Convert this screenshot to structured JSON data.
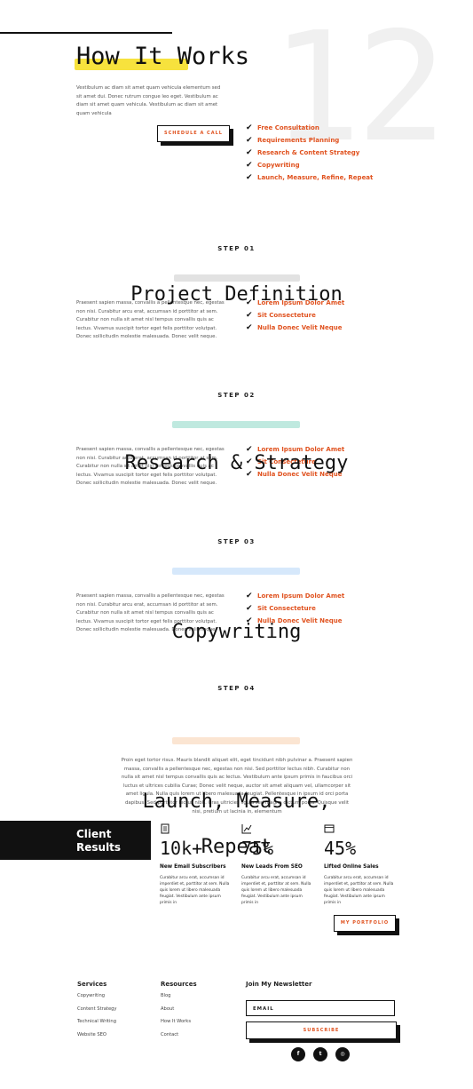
{
  "hero": {
    "big_number": "12",
    "title": "How It Works",
    "description": "Vestibulum ac diam sit amet quam vehicula elementum sed sit amet dui. Donec rutrum congue leo eget. Vestibulum ac diam sit amet quam vehicula. Vestibulum ac diam sit amet quam vehicula",
    "button_label": "SCHEDULE A CALL",
    "checklist": [
      "Free Consultation",
      "Requirements Planning",
      "Research & Content Strategy",
      "Copywriting",
      "Launch, Measure, Refine, Repeat"
    ]
  },
  "steps": [
    {
      "label": "STEP 01",
      "title": "Project Definition",
      "body": "Praesent sapien massa, convallis a pellentesque nec, egestas non nisi. Curabitur arcu erat, accumsan id porttitor at sem. Curabitur non nulla sit amet nisl tempus convallis quis ac lectus. Vivamus suscipit tortor eget felis porttitor volutpat. Donec sollicitudin molestie malesuada. Donec velit neque.",
      "checklist": [
        "Lorem Ipsum Dolor Amet",
        "Sit Consecteture",
        "Nulla Donec Velit Neque"
      ]
    },
    {
      "label": "STEP 02",
      "title": "Research & Strategy",
      "body": "Praesent sapien massa, convallis a pellentesque nec, egestas non nisi. Curabitur arcu erat, accumsan id porttitor at sem. Curabitur non nulla sit amet nisl tempus convallis quis ac lectus. Vivamus suscipit tortor eget felis porttitor volutpat. Donec sollicitudin molestie malesuada. Donec velit neque.",
      "checklist": [
        "Lorem Ipsum Dolor Amet",
        "Sit Consecteture",
        "Nulla Donec Velit Neque"
      ]
    },
    {
      "label": "STEP 03",
      "title": "Copywriting",
      "body": "Praesent sapien massa, convallis a pellentesque nec, egestas non nisi. Curabitur arcu erat, accumsan id porttitor at sem. Curabitur non nulla sit amet nisl tempus convallis quis ac lectus. Vivamus suscipit tortor eget felis porttitor volutpat. Donec sollicitudin molestie malesuada. Donec velit neque.",
      "checklist": [
        "Lorem Ipsum Dolor Amet",
        "Sit Consecteture",
        "Nulla Donec Velit Neque"
      ]
    },
    {
      "label": "STEP 04",
      "title_line1": "Launch, Measure,",
      "title_line2": "Repeat",
      "body": "Proin eget tortor risus. Mauris blandit aliquet elit, eget tincidunt nibh pulvinar a. Praesent sapien massa, convallis a pellentesque nec, egestas non nisi. Sed porttitor lectus nibh. Curabitur non nulla sit amet nisl tempus convallis quis ac lectus. Vestibulum ante ipsum primis in faucibus orci luctus et ultrices cubilia Curae; Donec velit neque, auctor sit amet aliquam vel, ullamcorper sit amet ligula. Nulla quis lorem ut libero malesuada feugiat. Pellentesque in ipsum id orci porta dapibus. Sed porttitor lectus nibh. Cras ultricies ligula sed magna dictum porta. Quisque velit nisi, pretium ut lacinia in, elementum"
    }
  ],
  "results": {
    "title_line1": "Client",
    "title_line2": "Results",
    "stats": [
      {
        "icon": "document-icon",
        "value": "10k+",
        "label": "New Email Subscribers",
        "desc": "Curabitur arcu erat, accumsan id imperdiet et, porttitor at sem. Nulla quis lorem ut libero malesuada feugiat. Vestibulum ante ipsum primis in"
      },
      {
        "icon": "chart-icon",
        "value": "75%",
        "label": "New Leads From SEO",
        "desc": "Curabitur arcu erat, accumsan id imperdiet et, porttitor at sem. Nulla quis lorem ut libero malesuada feugiat. Vestibulum ante ipsum primis in"
      },
      {
        "icon": "browser-icon",
        "value": "45%",
        "label": "Lifted Online Sales",
        "desc": "Curabitur arcu erat, accumsan id imperdiet et, porttitor at sem. Nulla quis lorem ut libero malesuada feugiat. Vestibulum ante ipsum primis in"
      }
    ],
    "button_label": "MY PORTFOLIO"
  },
  "footer": {
    "services_heading": "Services",
    "services": [
      "Copywriting",
      "Content Strategy",
      "Technical Writing",
      "Website SEO"
    ],
    "resources_heading": "Resources",
    "resources": [
      "Blog",
      "About",
      "How It Works",
      "Contact"
    ],
    "newsletter_heading": "Join My Newsletter",
    "email_placeholder": "EMAIL",
    "subscribe_label": "SUBSCRIBE",
    "social": [
      {
        "icon": "facebook-icon",
        "glyph": "f"
      },
      {
        "icon": "twitter-icon",
        "glyph": "t"
      },
      {
        "icon": "instagram-icon",
        "glyph": "◎"
      }
    ]
  },
  "colors": {
    "accent": "#e0521f",
    "highlight_yellow": "#f7e23d",
    "dark": "#111111"
  }
}
